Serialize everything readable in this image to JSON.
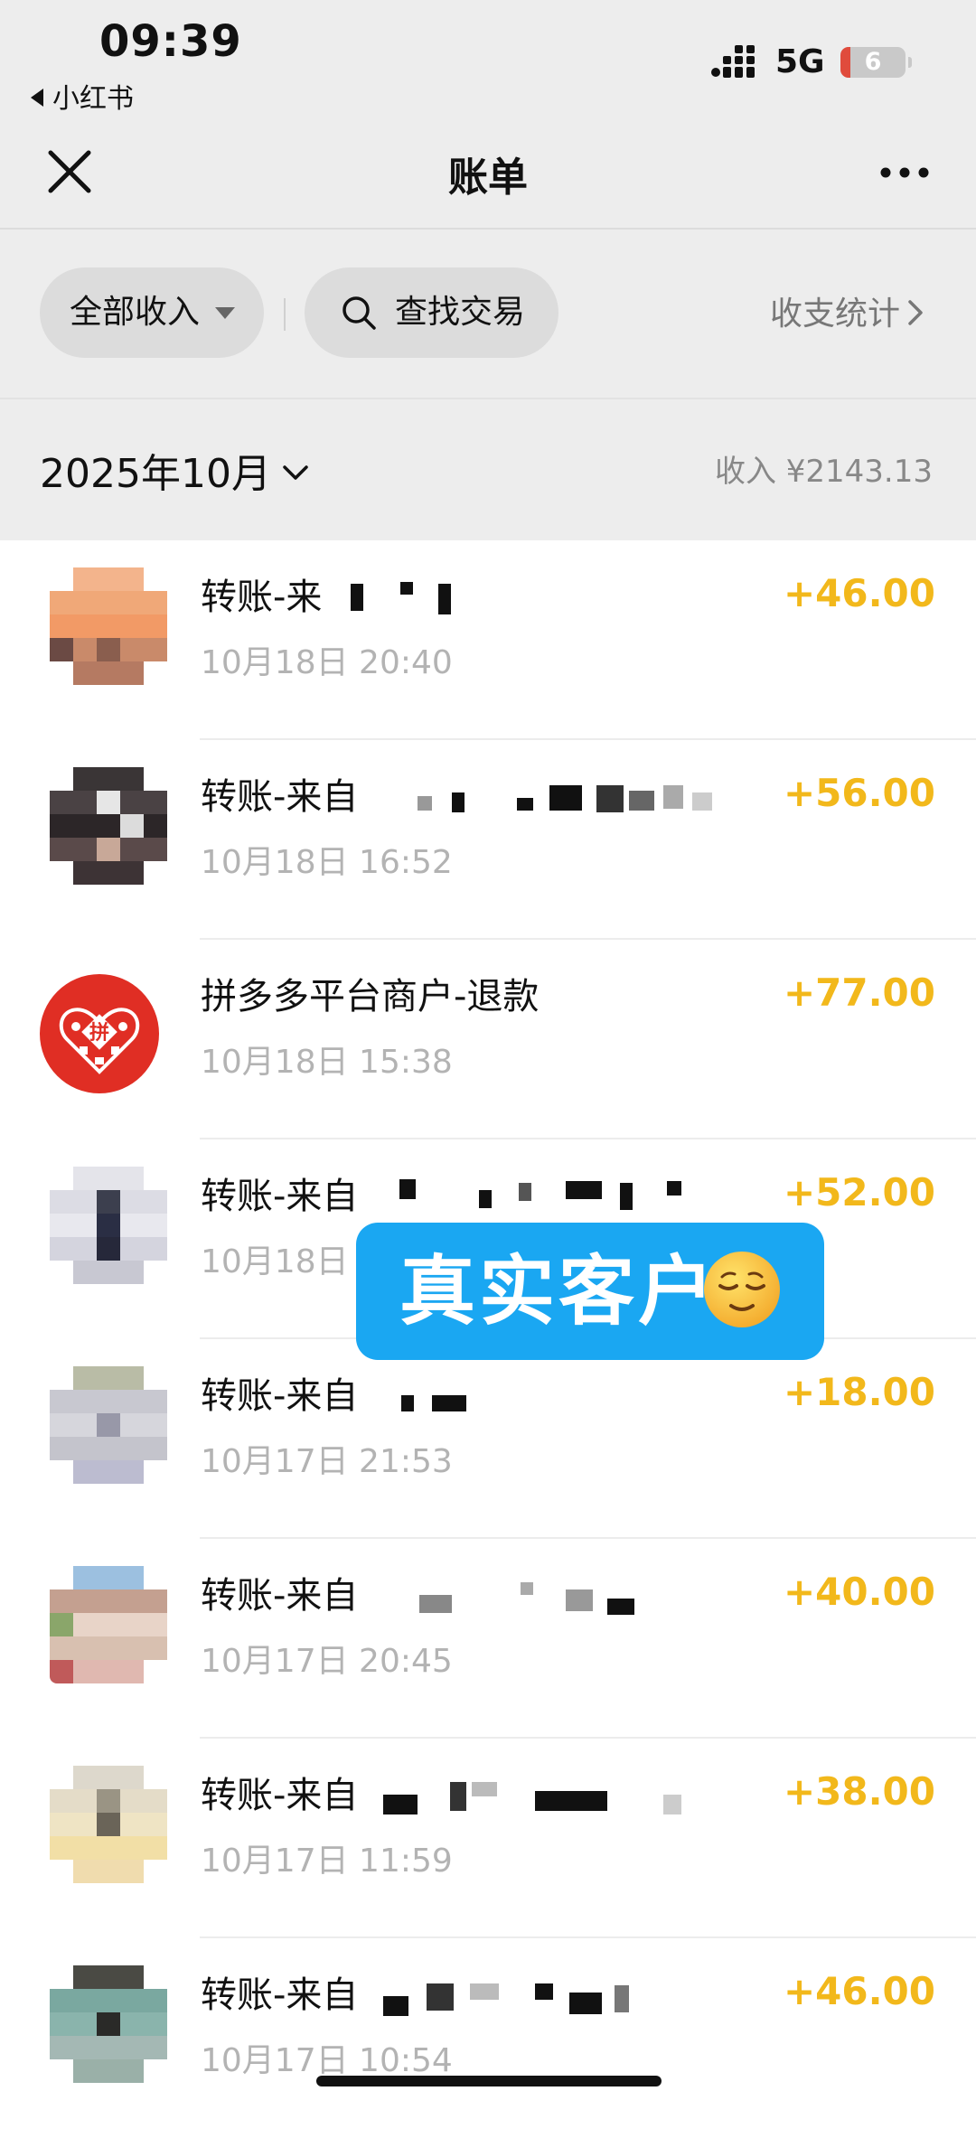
{
  "status_bar": {
    "time": "09:39",
    "back_app": "小红书",
    "network": "5G",
    "battery": "6"
  },
  "nav": {
    "title": "账单",
    "close_icon": "close-icon",
    "more_icon": "more-icon"
  },
  "filters": {
    "income_filter": "全部收入",
    "search": "查找交易",
    "stats": "收支统计"
  },
  "month": {
    "label": "2025年10月",
    "income_total": "收入 ¥2143.13"
  },
  "transactions": [
    {
      "title": "转账-来",
      "time": "10月18日 20:40",
      "amount": "+46.00"
    },
    {
      "title": "转账-来自",
      "time": "10月18日 16:52",
      "amount": "+56.00"
    },
    {
      "title": "拼多多平台商户-退款",
      "time": "10月18日 15:38",
      "amount": "+77.00"
    },
    {
      "title": "转账-来自",
      "time": "10月18日",
      "amount": "+52.00"
    },
    {
      "title": "转账-来自",
      "time": "10月17日 21:53",
      "amount": "+18.00"
    },
    {
      "title": "转账-来自",
      "time": "10月17日 20:45",
      "amount": "+40.00"
    },
    {
      "title": "转账-来自",
      "time": "10月17日 11:59",
      "amount": "+38.00"
    },
    {
      "title": "转账-来自",
      "time": "10月17日 10:54",
      "amount": "+46.00"
    }
  ],
  "overlay": {
    "text": "真实客户",
    "emoji": "relieved-face-emoji"
  },
  "colors": {
    "amount": "#f2b81b",
    "overlay_bg": "#1aa7f2",
    "pdd_red": "#e02e24"
  }
}
